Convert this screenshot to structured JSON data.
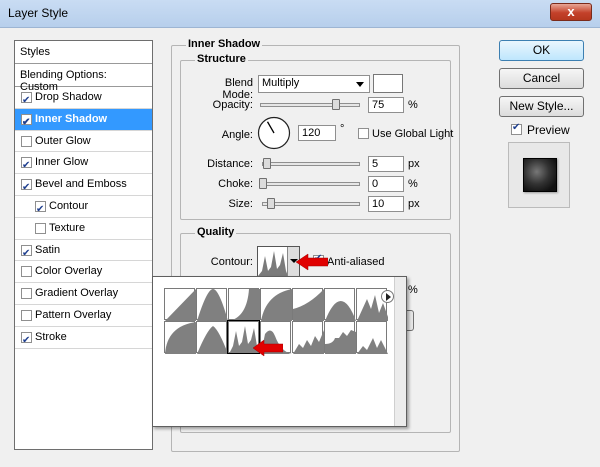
{
  "window": {
    "title": "Layer Style",
    "close_glyph": "x"
  },
  "styles": {
    "header": "Styles",
    "blending": "Blending Options: Custom",
    "items": [
      {
        "label": "Drop Shadow",
        "checked": true,
        "selected": false,
        "indent": false
      },
      {
        "label": "Inner Shadow",
        "checked": true,
        "selected": true,
        "indent": false
      },
      {
        "label": "Outer Glow",
        "checked": false,
        "selected": false,
        "indent": false
      },
      {
        "label": "Inner Glow",
        "checked": true,
        "selected": false,
        "indent": false
      },
      {
        "label": "Bevel and Emboss",
        "checked": true,
        "selected": false,
        "indent": false
      },
      {
        "label": "Contour",
        "checked": true,
        "selected": false,
        "indent": true
      },
      {
        "label": "Texture",
        "checked": false,
        "selected": false,
        "indent": true
      },
      {
        "label": "Satin",
        "checked": true,
        "selected": false,
        "indent": false
      },
      {
        "label": "Color Overlay",
        "checked": false,
        "selected": false,
        "indent": false
      },
      {
        "label": "Gradient Overlay",
        "checked": false,
        "selected": false,
        "indent": false
      },
      {
        "label": "Pattern Overlay",
        "checked": false,
        "selected": false,
        "indent": false
      },
      {
        "label": "Stroke",
        "checked": true,
        "selected": false,
        "indent": false
      }
    ]
  },
  "inner_shadow": {
    "title": "Inner Shadow",
    "structure": {
      "title": "Structure",
      "blend_mode_label": "Blend Mode:",
      "blend_mode_value": "Multiply",
      "opacity_label": "Opacity:",
      "opacity_value": "75",
      "opacity_unit": "%",
      "opacity_level": 0.75,
      "angle_label": "Angle:",
      "angle_value": "120",
      "angle_unit": "°",
      "use_global_light_label": "Use Global Light",
      "use_global_light": false,
      "distance_label": "Distance:",
      "distance_value": "5",
      "distance_unit": "px",
      "choke_label": "Choke:",
      "choke_value": "0",
      "choke_unit": "%",
      "size_label": "Size:",
      "size_value": "10",
      "size_unit": "px"
    },
    "quality": {
      "title": "Quality",
      "contour_label": "Contour:",
      "anti_aliased_label": "Anti-aliased",
      "anti_aliased": true,
      "noise_unit": "%"
    }
  },
  "buttons": {
    "ok": "OK",
    "cancel": "Cancel",
    "new_style": "New Style...",
    "preview_label": "Preview",
    "preview_checked": true
  },
  "colors": {
    "selection": "#3399ff",
    "arrow": "#e00000",
    "shadow_color": "#ffffff"
  },
  "icons": {
    "dropdown": "chevron-down-icon",
    "menu": "flyout-menu-icon",
    "angle": "angle-dial-icon",
    "pointer": "red-arrow-icon"
  }
}
